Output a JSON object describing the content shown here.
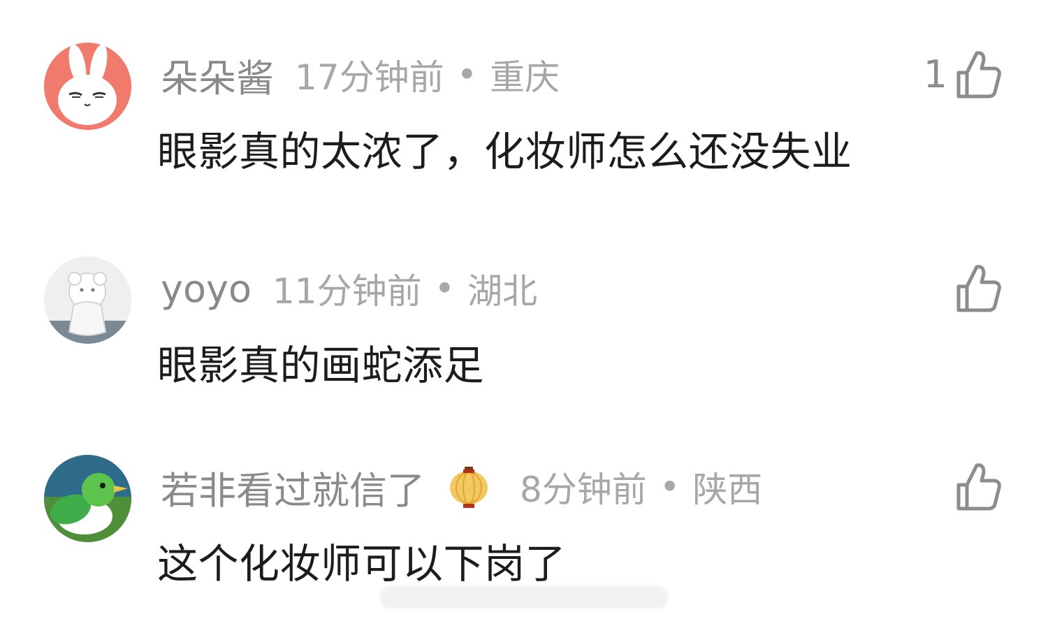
{
  "comments": [
    {
      "username": "朵朵酱",
      "time": "17分钟前",
      "separator": "•",
      "location": "重庆",
      "text": "眼影真的太浓了，化妆师怎么还没失业",
      "like_count": "1",
      "avatar_icon": "white-rabbit-avatar",
      "avatar_color": "#f07a6c"
    },
    {
      "username": "yoyo",
      "time": "11分钟前",
      "separator": "•",
      "location": "湖北",
      "text": "眼影真的画蛇添足",
      "like_count": "",
      "avatar_icon": "white-figurine-avatar",
      "avatar_color": "#d9dde0"
    },
    {
      "username": "若非看过就信了",
      "time": "8分钟前",
      "separator": "•",
      "location": "陕西",
      "text": "这个化妆师可以下岗了",
      "like_count": "",
      "avatar_icon": "green-bird-avatar",
      "badge_icon": "lantern-badge-icon",
      "avatar_color": "#4c9a45"
    }
  ],
  "colors": {
    "meta_text": "#a7a7a7",
    "username": "#8a8a8a",
    "body_text": "#1c1c1c",
    "like_icon": "#8c8c8c"
  }
}
